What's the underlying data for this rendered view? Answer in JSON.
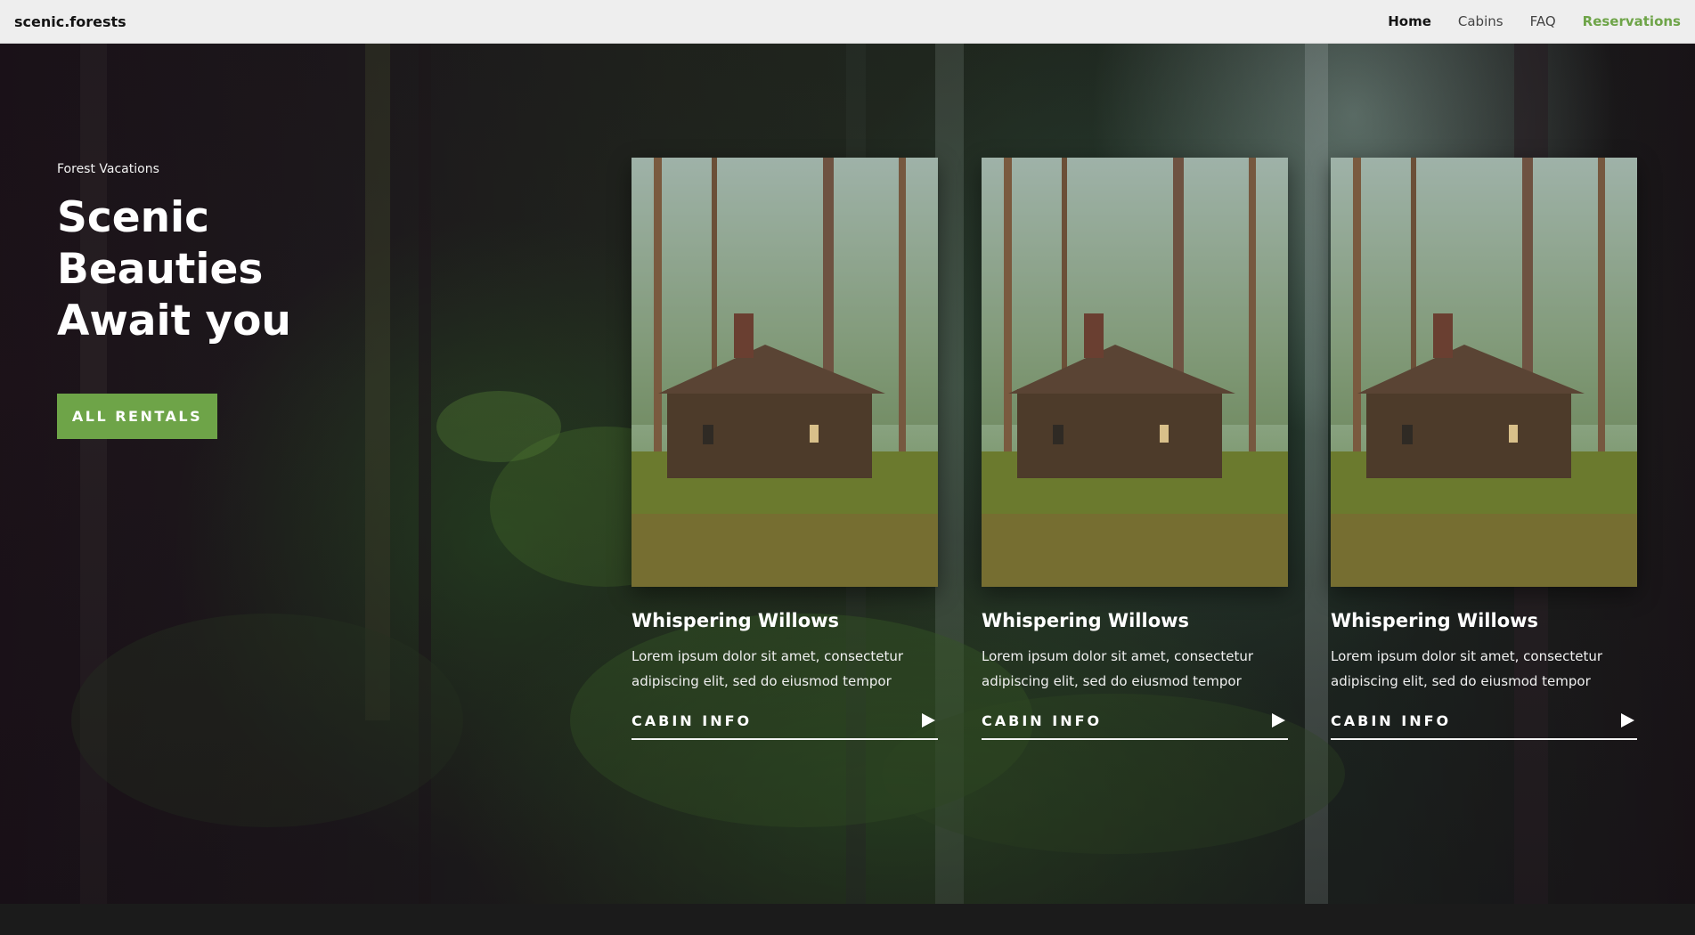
{
  "brand": "scenic.forests",
  "nav": {
    "home": "Home",
    "cabins": "Cabins",
    "faq": "FAQ",
    "reservations": "Reservations"
  },
  "hero": {
    "eyebrow": "Forest Vacations",
    "title": "Scenic Beauties Await you",
    "button": "ALL RENTALS"
  },
  "cards": [
    {
      "title": "Whispering Willows",
      "description": "Lorem ipsum dolor sit amet, consectetur adipiscing elit, sed do eiusmod tempor",
      "link": "CABIN INFO"
    },
    {
      "title": "Whispering Willows",
      "description": "Lorem ipsum dolor sit amet, consectetur adipiscing elit, sed do eiusmod tempor",
      "link": "CABIN INFO"
    },
    {
      "title": "Whispering Willows",
      "description": "Lorem ipsum dolor sit amet, consectetur adipiscing elit, sed do eiusmod tempor",
      "link": "CABIN INFO"
    }
  ],
  "icons": {
    "card_link_icon": "play-triangle-icon"
  },
  "colors": {
    "accent": "#6ea448",
    "nav_background": "#eeeeee",
    "text_dark": "#141414"
  }
}
